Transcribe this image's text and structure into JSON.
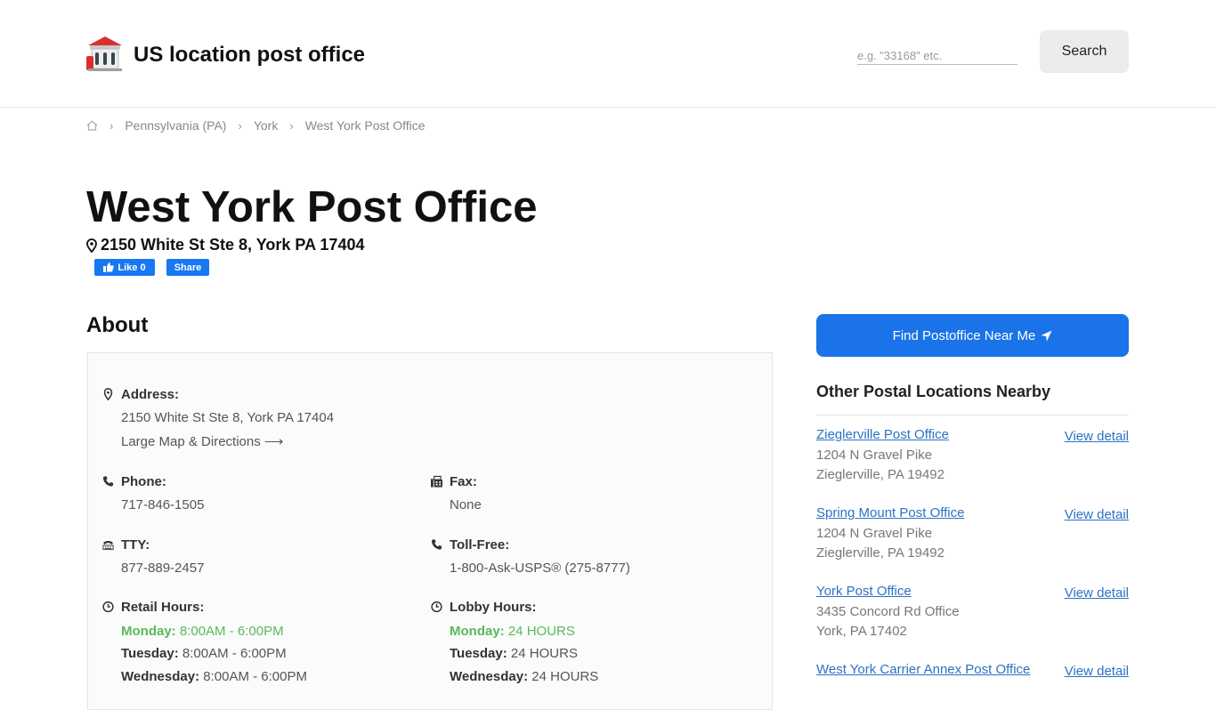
{
  "header": {
    "site_title": "US location post office",
    "search_placeholder": "e.g. \"33168\" etc.",
    "search_button": "Search"
  },
  "breadcrumb": {
    "items": [
      "Pennsylvania (PA)",
      "York",
      "West York Post Office"
    ]
  },
  "office": {
    "title": "West York Post Office",
    "address": "2150 White St Ste 8, York PA 17404",
    "fb_like": "Like 0",
    "fb_share": "Share"
  },
  "about": {
    "heading": "About",
    "address_label": "Address:",
    "address_value": "2150 White St Ste 8, York PA 17404",
    "map_link": "Large Map & Directions",
    "phone_label": "Phone:",
    "phone_value": "717-846-1505",
    "fax_label": "Fax:",
    "fax_value": "None",
    "tty_label": "TTY:",
    "tty_value": "877-889-2457",
    "tollfree_label": "Toll-Free:",
    "tollfree_value": "1-800-Ask-USPS® (275-8777)",
    "retail_label": "Retail Hours:",
    "retail_hours": [
      {
        "day": "Monday:",
        "hours": "8:00AM - 6:00PM",
        "today": true
      },
      {
        "day": "Tuesday:",
        "hours": "8:00AM - 6:00PM",
        "today": false
      },
      {
        "day": "Wednesday:",
        "hours": "8:00AM - 6:00PM",
        "today": false
      }
    ],
    "lobby_label": "Lobby Hours:",
    "lobby_hours": [
      {
        "day": "Monday:",
        "hours": "24 HOURS",
        "today": true
      },
      {
        "day": "Tuesday:",
        "hours": "24 HOURS",
        "today": false
      },
      {
        "day": "Wednesday:",
        "hours": "24 HOURS",
        "today": false
      }
    ]
  },
  "sidebar": {
    "find_button": "Find Postoffice Near Me",
    "nearby_heading": "Other Postal Locations Nearby",
    "view_label": "View detail",
    "items": [
      {
        "name": "Zieglerville Post Office",
        "line1": "1204 N Gravel Pike",
        "line2": "Zieglerville, PA 19492"
      },
      {
        "name": "Spring Mount Post Office",
        "line1": "1204 N Gravel Pike",
        "line2": "Zieglerville, PA 19492"
      },
      {
        "name": "York Post Office",
        "line1": "3435 Concord Rd Office",
        "line2": "York, PA 17402"
      },
      {
        "name": "West York Carrier Annex Post Office",
        "line1": "",
        "line2": ""
      }
    ]
  },
  "colors": {
    "accent": "#1a73e8",
    "link": "#2b72c4",
    "today_green": "#5cb85c",
    "facebook": "#1877f2"
  }
}
